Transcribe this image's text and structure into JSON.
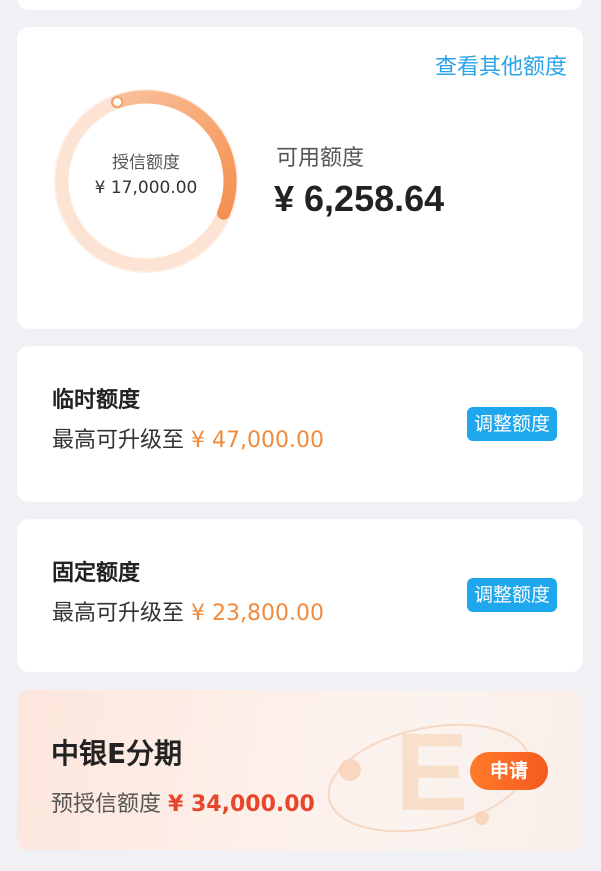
{
  "header": {
    "view_other_limits": "查看其他额度"
  },
  "credit": {
    "granted_label": "授信额度",
    "granted_value": "¥ 17,000.00",
    "available_label": "可用额度",
    "available_value": "¥ 6,258.64",
    "ring_colors": {
      "track": "#fde3d4",
      "arc": "#f6a06a"
    }
  },
  "temporary": {
    "title": "临时额度",
    "prefix": "最高可升级至",
    "amount": "¥ 47,000.00",
    "button": "调整额度"
  },
  "fixed": {
    "title": "固定额度",
    "prefix": "最高可升级至",
    "amount": "¥ 23,800.00",
    "button": "调整额度"
  },
  "promo": {
    "title": "中银E分期",
    "prefix": "预授信额度",
    "amount": "¥ 34,000.00",
    "button": "申请"
  },
  "colors": {
    "accent_blue": "#1ea7ec",
    "amount_orange": "#f08a3c",
    "promo_red": "#e8462a",
    "background": "#f0f0f5"
  }
}
